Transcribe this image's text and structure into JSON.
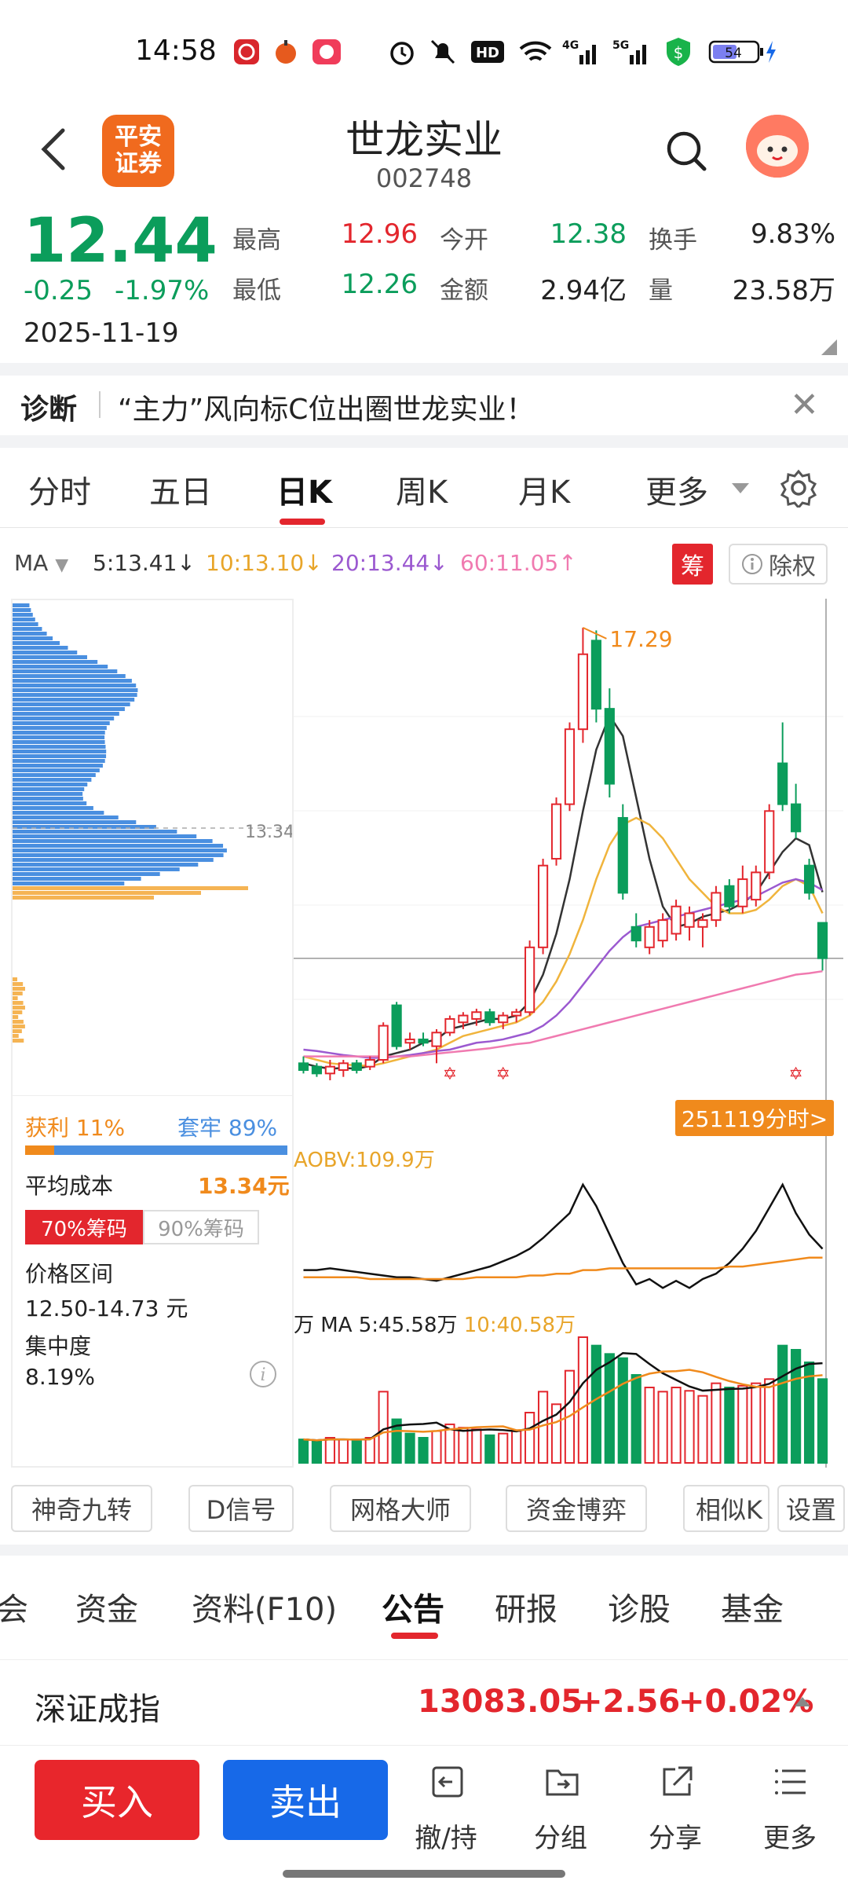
{
  "status_bar": {
    "time": "14:58",
    "battery": "54",
    "net1": "4G",
    "net2": "5G"
  },
  "header": {
    "broker_logo": "平安\n证券",
    "stock_name": "世龙实业",
    "stock_code": "002748"
  },
  "quote": {
    "price": "12.44",
    "change": "-0.25",
    "change_pct": "-1.97%",
    "date": "2025-11-19",
    "high_label": "最高",
    "high": "12.96",
    "low_label": "最低",
    "low": "12.26",
    "open_label": "今开",
    "open": "12.38",
    "amount_label": "金额",
    "amount": "2.94亿",
    "turnover_label": "换手",
    "turnover": "9.83%",
    "volume_label": "量",
    "volume": "23.58万"
  },
  "diagnosis": {
    "tag": "诊断",
    "text": "“主力”风向标C位出圈世龙实业！"
  },
  "chart_tabs": [
    {
      "label": "分时"
    },
    {
      "label": "五日"
    },
    {
      "label": "日K"
    },
    {
      "label": "周K"
    },
    {
      "label": "月K"
    },
    {
      "label": "更多"
    }
  ],
  "ma_row": {
    "ma_label": "MA",
    "ma5": "5:13.41↓",
    "ma10": "10:13.10↓",
    "ma20": "20:13.44↓",
    "ma60": "60:11.05↑",
    "chou": "筹",
    "chuquan": "除权"
  },
  "chip": {
    "profit_label": "获利 11%",
    "trapped_label": "套牢 89%",
    "profit_pct": 11,
    "avg_cost_label": "平均成本",
    "avg_cost": "13.34元",
    "btn70": "70%筹码",
    "btn90": "90%筹码",
    "range_label": "价格区间",
    "range": "12.50-14.73 元",
    "concentration_label": "集中度",
    "concentration": "8.19%",
    "cost_line_label": "13.34"
  },
  "chart_text": {
    "high_mark": "17.29",
    "fenshi_btn": "251119分时>",
    "aobv_label": "AOBV:109.9万",
    "vol_label": "万 MA 5:45.58万",
    "vol_label2": "10:40.58万"
  },
  "tools": [
    {
      "label": "神奇九转"
    },
    {
      "label": "D信号"
    },
    {
      "label": "网格大师"
    },
    {
      "label": "资金博弈"
    },
    {
      "label": "相似K"
    },
    {
      "label": "设置"
    }
  ],
  "bottom_tabs": [
    {
      "label": "会"
    },
    {
      "label": "资金"
    },
    {
      "label": "资料(F10)"
    },
    {
      "label": "公告"
    },
    {
      "label": "研报"
    },
    {
      "label": "诊股"
    },
    {
      "label": "基金"
    }
  ],
  "index": {
    "name": "深证成指",
    "value": "13083.05",
    "change": "+2.56",
    "pct": "+0.02%"
  },
  "bottom_bar": {
    "buy": "买入",
    "sell": "卖出",
    "cancel": "撤/持",
    "group": "分组",
    "share": "分享",
    "more": "更多"
  },
  "colors": {
    "up": "#e3262d",
    "down": "#0b9d5b",
    "accent_orange": "#f08a1c",
    "blue": "#1769e8"
  },
  "chart_data": {
    "type": "candlestick",
    "ylim": [
      10.8,
      17.6
    ],
    "high_annotation": 17.29,
    "candles": [
      {
        "o": 10.9,
        "h": 11.0,
        "l": 10.75,
        "c": 10.8
      },
      {
        "o": 10.85,
        "h": 10.9,
        "l": 10.7,
        "c": 10.75
      },
      {
        "o": 10.75,
        "h": 10.95,
        "l": 10.65,
        "c": 10.85
      },
      {
        "o": 10.8,
        "h": 10.95,
        "l": 10.7,
        "c": 10.9
      },
      {
        "o": 10.9,
        "h": 10.95,
        "l": 10.75,
        "c": 10.8
      },
      {
        "o": 10.85,
        "h": 11.0,
        "l": 10.8,
        "c": 10.95
      },
      {
        "o": 10.95,
        "h": 11.5,
        "l": 10.9,
        "c": 11.45
      },
      {
        "o": 11.75,
        "h": 11.8,
        "l": 11.1,
        "c": 11.15
      },
      {
        "o": 11.2,
        "h": 11.35,
        "l": 11.1,
        "c": 11.25
      },
      {
        "o": 11.25,
        "h": 11.35,
        "l": 11.15,
        "c": 11.2
      },
      {
        "o": 11.15,
        "h": 11.4,
        "l": 10.9,
        "c": 11.35
      },
      {
        "o": 11.35,
        "h": 11.6,
        "l": 11.3,
        "c": 11.55
      },
      {
        "o": 11.5,
        "h": 11.65,
        "l": 11.4,
        "c": 11.6
      },
      {
        "o": 11.55,
        "h": 11.7,
        "l": 11.45,
        "c": 11.65
      },
      {
        "o": 11.65,
        "h": 11.7,
        "l": 11.45,
        "c": 11.5
      },
      {
        "o": 11.5,
        "h": 11.65,
        "l": 11.4,
        "c": 11.6
      },
      {
        "o": 11.6,
        "h": 11.7,
        "l": 11.5,
        "c": 11.65
      },
      {
        "o": 11.65,
        "h": 12.7,
        "l": 11.6,
        "c": 12.6
      },
      {
        "o": 12.6,
        "h": 13.9,
        "l": 12.5,
        "c": 13.8
      },
      {
        "o": 13.9,
        "h": 14.8,
        "l": 13.8,
        "c": 14.7
      },
      {
        "o": 14.7,
        "h": 15.9,
        "l": 14.6,
        "c": 15.8
      },
      {
        "o": 15.8,
        "h": 17.29,
        "l": 15.6,
        "c": 16.9
      },
      {
        "o": 17.1,
        "h": 17.25,
        "l": 15.9,
        "c": 16.1
      },
      {
        "o": 16.1,
        "h": 16.4,
        "l": 14.8,
        "c": 15.0
      },
      {
        "o": 14.5,
        "h": 14.7,
        "l": 13.3,
        "c": 13.4
      },
      {
        "o": 12.9,
        "h": 13.1,
        "l": 12.6,
        "c": 12.7
      },
      {
        "o": 12.6,
        "h": 13.0,
        "l": 12.5,
        "c": 12.9
      },
      {
        "o": 12.7,
        "h": 13.1,
        "l": 12.6,
        "c": 13.0
      },
      {
        "o": 12.8,
        "h": 13.3,
        "l": 12.7,
        "c": 13.2
      },
      {
        "o": 12.9,
        "h": 13.2,
        "l": 12.7,
        "c": 13.1
      },
      {
        "o": 12.9,
        "h": 13.1,
        "l": 12.6,
        "c": 13.0
      },
      {
        "o": 13.0,
        "h": 13.5,
        "l": 12.9,
        "c": 13.4
      },
      {
        "o": 13.5,
        "h": 13.6,
        "l": 13.1,
        "c": 13.2
      },
      {
        "o": 13.2,
        "h": 13.8,
        "l": 13.1,
        "c": 13.6
      },
      {
        "o": 13.3,
        "h": 13.8,
        "l": 13.2,
        "c": 13.7
      },
      {
        "o": 13.7,
        "h": 14.7,
        "l": 13.6,
        "c": 14.6
      },
      {
        "o": 15.3,
        "h": 15.9,
        "l": 14.6,
        "c": 14.7
      },
      {
        "o": 14.7,
        "h": 15.0,
        "l": 14.2,
        "c": 14.3
      },
      {
        "o": 13.8,
        "h": 13.9,
        "l": 13.3,
        "c": 13.4
      },
      {
        "o": 12.96,
        "h": 12.96,
        "l": 12.26,
        "c": 12.44
      }
    ],
    "ma": [
      {
        "name": "MA5",
        "color": "#333333",
        "values": [
          10.9,
          10.85,
          10.82,
          10.83,
          10.82,
          10.86,
          11.0,
          11.05,
          11.1,
          11.2,
          11.25,
          11.4,
          11.45,
          11.5,
          11.55,
          11.55,
          11.6,
          11.8,
          12.2,
          12.8,
          13.6,
          14.6,
          15.5,
          16.0,
          15.7,
          14.8,
          13.9,
          13.2,
          12.9,
          12.95,
          13.05,
          13.1,
          13.15,
          13.25,
          13.4,
          13.7,
          14.0,
          14.2,
          14.1,
          13.41
        ]
      },
      {
        "name": "MA10",
        "color": "#f0b43c",
        "values": [
          11.0,
          10.95,
          10.9,
          10.88,
          10.87,
          10.86,
          10.9,
          10.95,
          11.0,
          11.05,
          11.1,
          11.2,
          11.3,
          11.35,
          11.4,
          11.45,
          11.5,
          11.6,
          11.8,
          12.1,
          12.5,
          13.0,
          13.6,
          14.1,
          14.4,
          14.5,
          14.4,
          14.2,
          13.9,
          13.6,
          13.4,
          13.2,
          13.1,
          13.1,
          13.15,
          13.3,
          13.5,
          13.6,
          13.5,
          13.1
        ]
      },
      {
        "name": "MA20",
        "color": "#9b59d0",
        "values": [
          11.1,
          11.08,
          11.05,
          11.02,
          11.0,
          10.98,
          10.98,
          11.0,
          11.02,
          11.05,
          11.08,
          11.1,
          11.15,
          11.2,
          11.22,
          11.25,
          11.3,
          11.35,
          11.45,
          11.6,
          11.8,
          12.05,
          12.3,
          12.55,
          12.75,
          12.9,
          12.95,
          13.0,
          13.05,
          13.1,
          13.15,
          13.2,
          13.25,
          13.3,
          13.35,
          13.45,
          13.55,
          13.6,
          13.55,
          13.44
        ]
      },
      {
        "name": "MA60",
        "color": "#f07ab0",
        "values": [
          11.0,
          11.0,
          11.0,
          11.0,
          11.0,
          11.0,
          11.0,
          11.0,
          11.0,
          11.02,
          11.04,
          11.06,
          11.08,
          11.1,
          11.12,
          11.15,
          11.18,
          11.2,
          11.25,
          11.3,
          11.35,
          11.4,
          11.45,
          11.5,
          11.55,
          11.6,
          11.65,
          11.7,
          11.75,
          11.8,
          11.85,
          11.9,
          11.95,
          12.0,
          12.05,
          12.1,
          12.15,
          12.2,
          12.22,
          12.25
        ]
      }
    ],
    "volume": [
      28,
      26,
      30,
      28,
      27,
      30,
      85,
      52,
      35,
      30,
      38,
      46,
      42,
      40,
      33,
      35,
      38,
      60,
      85,
      70,
      110,
      150,
      140,
      130,
      125,
      105,
      90,
      85,
      90,
      86,
      80,
      95,
      90,
      92,
      95,
      100,
      140,
      135,
      120,
      100
    ],
    "vol_up": [
      false,
      false,
      true,
      true,
      false,
      true,
      true,
      false,
      false,
      false,
      true,
      true,
      true,
      true,
      false,
      true,
      true,
      true,
      true,
      true,
      true,
      true,
      false,
      false,
      false,
      false,
      true,
      true,
      true,
      true,
      true,
      true,
      false,
      true,
      true,
      true,
      false,
      false,
      false,
      false
    ],
    "aobv": [
      60,
      60,
      61,
      60,
      59,
      58,
      57,
      56,
      56,
      55,
      54,
      56,
      58,
      60,
      62,
      65,
      68,
      72,
      78,
      85,
      92,
      108,
      96,
      80,
      64,
      52,
      55,
      50,
      54,
      50,
      55,
      58,
      64,
      72,
      82,
      95,
      108,
      92,
      80,
      72
    ],
    "aobv_ma": [
      56,
      56,
      56,
      56,
      56,
      55,
      55,
      55,
      55,
      55,
      55,
      55,
      55,
      56,
      56,
      56,
      56,
      57,
      57,
      58,
      58,
      60,
      60,
      61,
      61,
      61,
      61,
      61,
      61,
      61,
      61,
      61,
      62,
      62,
      63,
      64,
      65,
      66,
      67,
      67
    ]
  }
}
